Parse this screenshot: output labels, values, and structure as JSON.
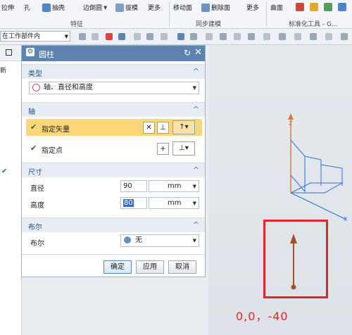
{
  "ribbon": {
    "items": [
      {
        "label": "拉伸"
      },
      {
        "label": "孔"
      },
      {
        "label": "抽壳"
      },
      {
        "label": "边倒圆"
      },
      {
        "label": "拔模"
      },
      {
        "label": "更多"
      },
      {
        "label": "移动面"
      },
      {
        "label": "删除面"
      },
      {
        "label": "更多"
      },
      {
        "label": "曲面"
      }
    ],
    "groups": {
      "feature": "特征",
      "sync": "同步建模",
      "standard": "标准化工具 - G..."
    }
  },
  "toolbar": {
    "selection_scope": "在工作部件内"
  },
  "left_nav": {
    "refresh_label": "新"
  },
  "dialog": {
    "title": "圆柱",
    "type_section": {
      "label": "类型",
      "value": "轴、直径和高度"
    },
    "axis_section": {
      "label": "轴",
      "specify_vector": "指定矢量",
      "specify_point": "指定点"
    },
    "dimension_section": {
      "label": "尺寸",
      "diameter_label": "直径",
      "diameter_value": "90",
      "diameter_unit": "mm",
      "height_label": "高度",
      "height_value": "80",
      "height_unit": "mm"
    },
    "boolean_section": {
      "label": "布尔",
      "boolean_label": "布尔",
      "boolean_value": "无"
    },
    "buttons": {
      "ok": "确定",
      "apply": "应用",
      "cancel": "取消"
    }
  },
  "annotation": {
    "coordinates_text": "0,0，-40",
    "box_color": "#e0262a"
  },
  "colors": {
    "title_bar": "#5d84b0",
    "section_text": "#1e4f86",
    "highlight_row": "#fdd77a",
    "axis_z": "#e07a35",
    "axis_xy": "#2b6fd8",
    "vector": "#a0522d"
  }
}
